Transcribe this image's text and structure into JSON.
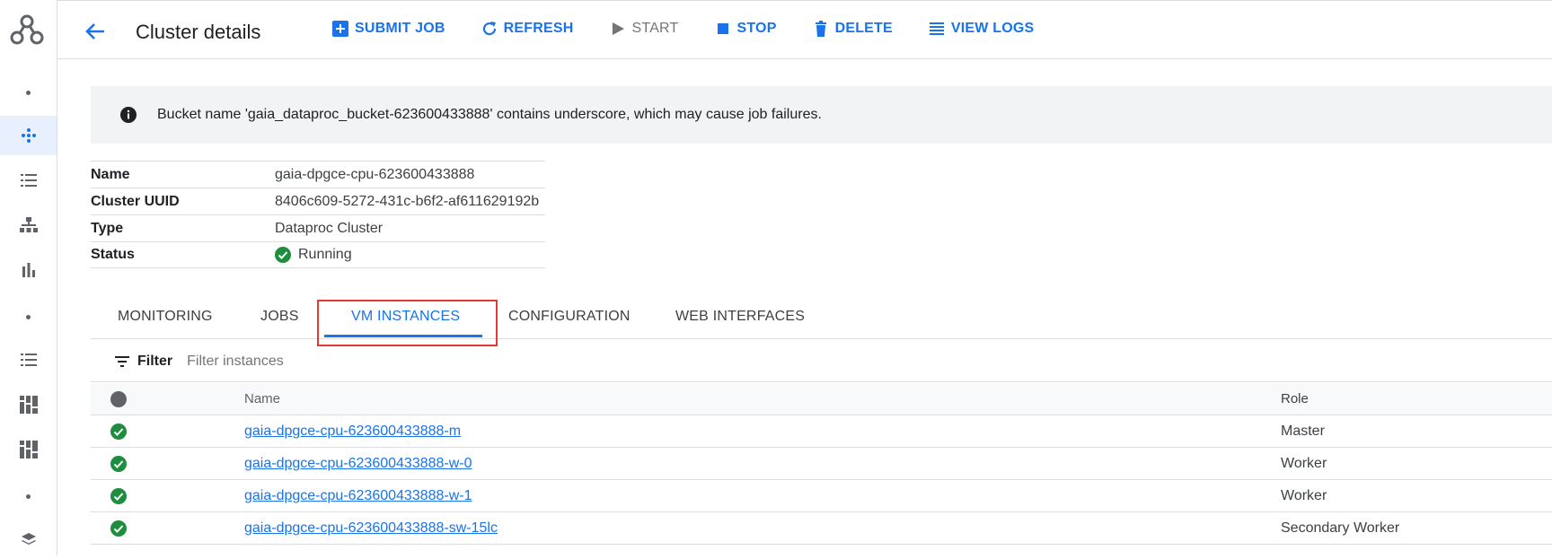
{
  "header": {
    "title": "Cluster details",
    "toolbar": [
      {
        "label": "SUBMIT JOB",
        "icon": "add-box-icon",
        "enabled": true
      },
      {
        "label": "REFRESH",
        "icon": "refresh-icon",
        "enabled": true
      },
      {
        "label": "START",
        "icon": "play-icon",
        "enabled": false
      },
      {
        "label": "STOP",
        "icon": "stop-icon",
        "enabled": true
      },
      {
        "label": "DELETE",
        "icon": "trash-icon",
        "enabled": true
      },
      {
        "label": "VIEW LOGS",
        "icon": "logs-icon",
        "enabled": true
      }
    ]
  },
  "banner": {
    "icon": "info-icon",
    "text": "Bucket name 'gaia_dataproc_bucket-623600433888' contains underscore, which may cause job failures."
  },
  "properties": [
    {
      "key": "Name",
      "value": "gaia-dpgce-cpu-623600433888"
    },
    {
      "key": "Cluster UUID",
      "value": "8406c609-5272-431c-b6f2-af611629192b"
    },
    {
      "key": "Type",
      "value": "Dataproc Cluster"
    },
    {
      "key": "Status",
      "value": "Running",
      "status_icon": "check-circle-icon"
    }
  ],
  "tabs": [
    {
      "label": "MONITORING",
      "active": false
    },
    {
      "label": "JOBS",
      "active": false
    },
    {
      "label": "VM INSTANCES",
      "active": true
    },
    {
      "label": "CONFIGURATION",
      "active": false
    },
    {
      "label": "WEB INTERFACES",
      "active": false
    }
  ],
  "filter": {
    "label": "Filter",
    "placeholder": "Filter instances"
  },
  "table": {
    "headers": {
      "name": "Name",
      "role": "Role"
    },
    "rows": [
      {
        "name": "gaia-dpgce-cpu-623600433888-m",
        "role": "Master"
      },
      {
        "name": "gaia-dpgce-cpu-623600433888-w-0",
        "role": "Worker"
      },
      {
        "name": "gaia-dpgce-cpu-623600433888-w-1",
        "role": "Worker"
      },
      {
        "name": "gaia-dpgce-cpu-623600433888-sw-15lc",
        "role": "Secondary Worker"
      }
    ]
  },
  "colors": {
    "accent": "#1a73e8",
    "success": "#1e8e3e",
    "highlight": "#e53935"
  }
}
